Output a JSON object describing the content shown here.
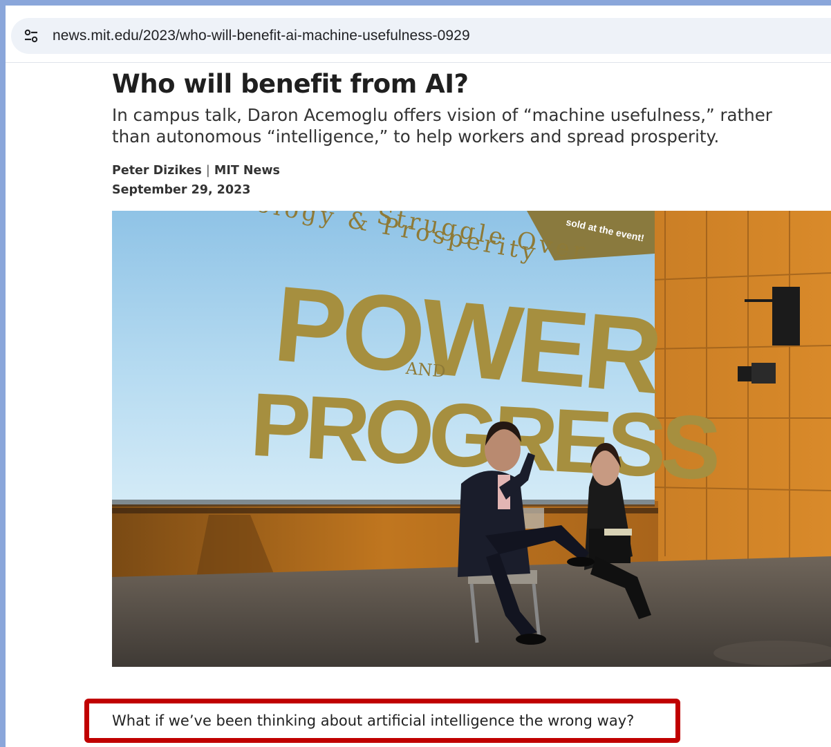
{
  "browser": {
    "url": "news.mit.edu/2023/who-will-benefit-ai-machine-usefulness-0929",
    "site_info_icon": "tune-icon"
  },
  "article": {
    "headline": "Who will benefit from AI?",
    "dek_line1": "In campus talk, Daron Acemoglu offers vision of “machine usefulness,” rather",
    "dek_line2": "than autonomous “intelligence,” to help workers and spread prosperity.",
    "author": "Peter Dizikes",
    "separator": "|",
    "source": "MIT News",
    "date": "September 29, 2023",
    "first_sentence": "What if we’ve been thinking about artificial intelligence the wrong way?"
  },
  "photo": {
    "banner_text": "sold at the event!",
    "subtitle_line1": "Struggle Over",
    "subtitle_line2": "ology & Prosperity",
    "title_word1": "POWER",
    "title_and": "AND",
    "title_word2": "PROGRESS"
  },
  "colors": {
    "callout_border": "#c00000",
    "page_background": "#8aa6da"
  }
}
